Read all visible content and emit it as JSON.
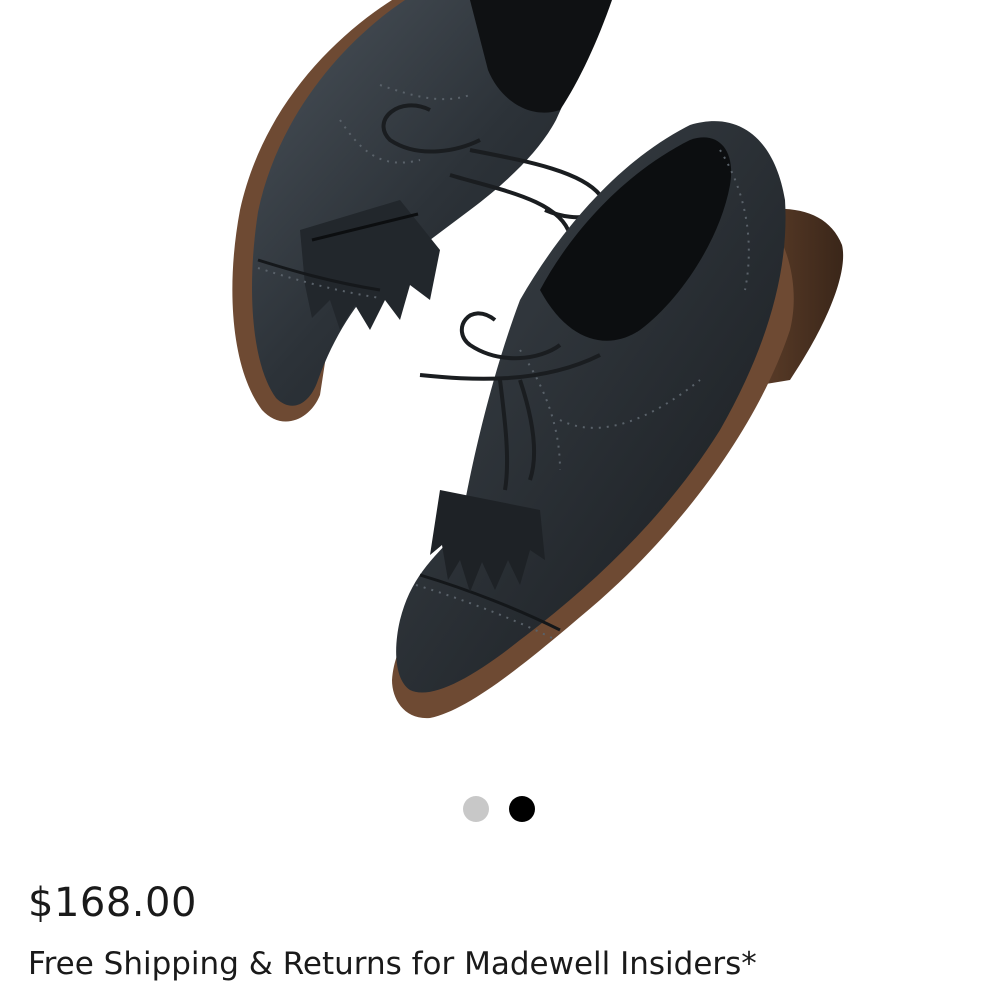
{
  "product": {
    "image_alt": "black leather kiltie oxford shoes",
    "image_icon": "shoe-pair-image"
  },
  "pager": {
    "total": 2,
    "active_index": 1,
    "inactive_color": "#c8c8c8",
    "active_color": "#000000"
  },
  "pricing": {
    "price": "$168.00",
    "shipping_note": "Free Shipping & Returns for Madewell Insiders*"
  }
}
